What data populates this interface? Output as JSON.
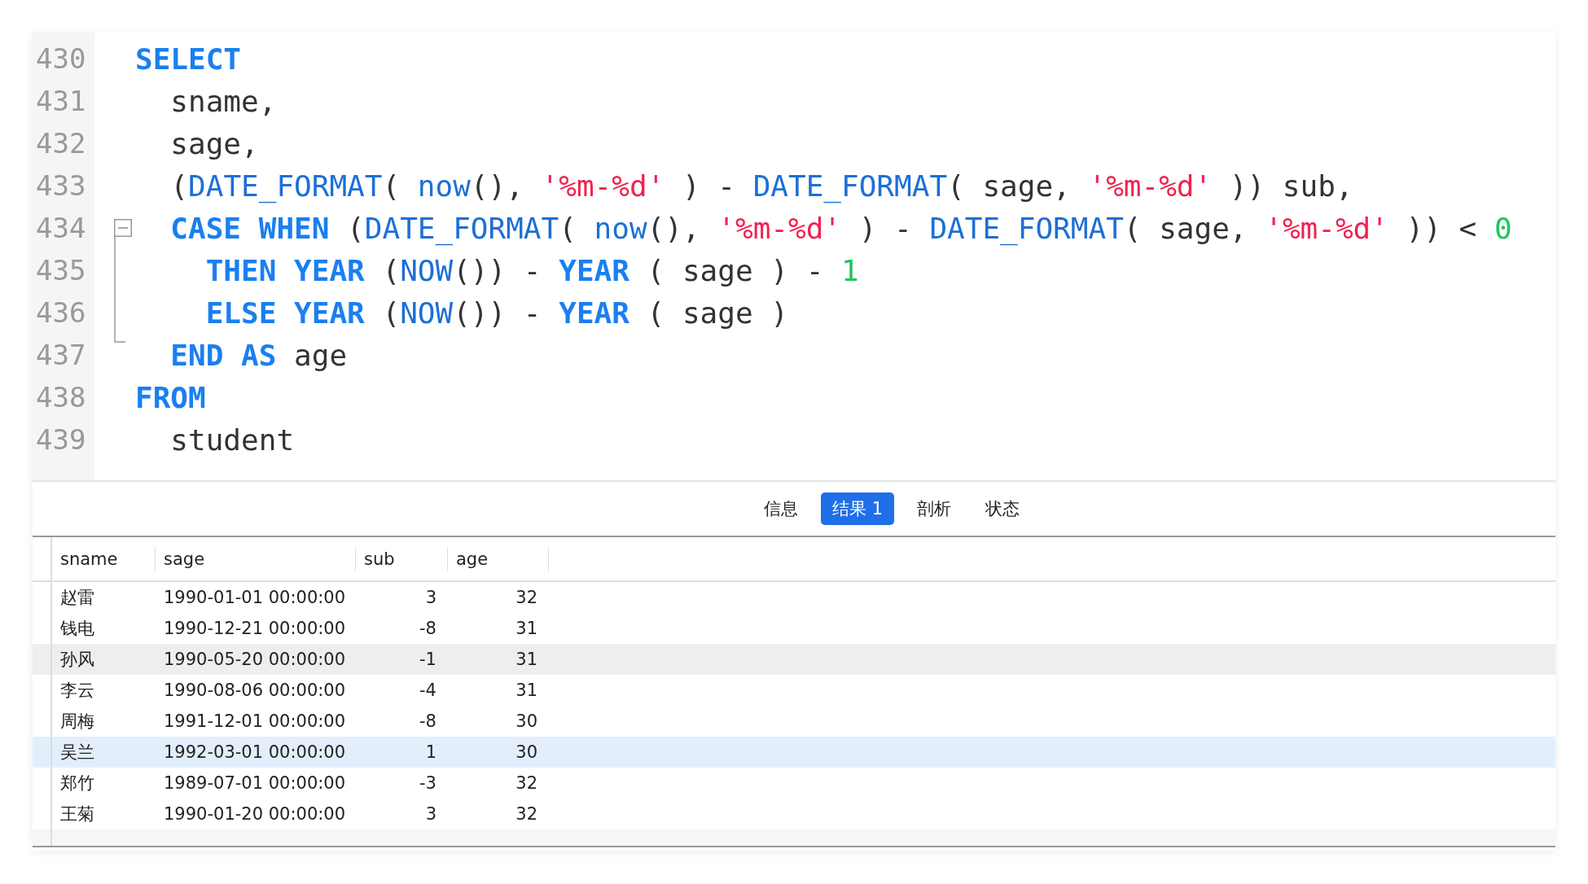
{
  "editor": {
    "lines": [
      {
        "number": "430",
        "tokens": [
          {
            "kind": "keyword",
            "text": "SELECT"
          }
        ]
      },
      {
        "number": "431",
        "tokens": [
          {
            "kind": "plain",
            "text": "  sname,"
          }
        ]
      },
      {
        "number": "432",
        "tokens": [
          {
            "kind": "plain",
            "text": "  sage,"
          }
        ]
      },
      {
        "number": "433",
        "tokens": [
          {
            "kind": "plain",
            "text": "  ("
          },
          {
            "kind": "function",
            "text": "DATE_FORMAT"
          },
          {
            "kind": "plain",
            "text": "( "
          },
          {
            "kind": "function",
            "text": "now"
          },
          {
            "kind": "plain",
            "text": "(), "
          },
          {
            "kind": "string",
            "text": "'%m-%d'"
          },
          {
            "kind": "plain",
            "text": " ) - "
          },
          {
            "kind": "function",
            "text": "DATE_FORMAT"
          },
          {
            "kind": "plain",
            "text": "( sage, "
          },
          {
            "kind": "string",
            "text": "'%m-%d'"
          },
          {
            "kind": "plain",
            "text": " )) sub,"
          }
        ]
      },
      {
        "number": "434",
        "expanded": true,
        "tokens": [
          {
            "kind": "keyword",
            "text": "  CASE WHEN"
          },
          {
            "kind": "plain",
            "text": " ("
          },
          {
            "kind": "function",
            "text": "DATE_FORMAT"
          },
          {
            "kind": "plain",
            "text": "( "
          },
          {
            "kind": "function",
            "text": "now"
          },
          {
            "kind": "plain",
            "text": "(), "
          },
          {
            "kind": "string",
            "text": "'%m-%d'"
          },
          {
            "kind": "plain",
            "text": " ) - "
          },
          {
            "kind": "function",
            "text": "DATE_FORMAT"
          },
          {
            "kind": "plain",
            "text": "( sage, "
          },
          {
            "kind": "string",
            "text": "'%m-%d'"
          },
          {
            "kind": "plain",
            "text": " )) < "
          },
          {
            "kind": "number",
            "text": "0"
          }
        ],
        "children": [
          {
            "number": "435",
            "tokens": [
              {
                "kind": "keyword",
                "text": "    THEN YEAR"
              },
              {
                "kind": "plain",
                "text": " ("
              },
              {
                "kind": "function",
                "text": "NOW"
              },
              {
                "kind": "plain",
                "text": "()) - "
              },
              {
                "kind": "keyword",
                "text": "YEAR"
              },
              {
                "kind": "plain",
                "text": " ( sage ) - "
              },
              {
                "kind": "number",
                "text": "1"
              }
            ]
          },
          {
            "number": "436",
            "tokens": [
              {
                "kind": "keyword",
                "text": "    ELSE YEAR"
              },
              {
                "kind": "plain",
                "text": " ("
              },
              {
                "kind": "function",
                "text": "NOW"
              },
              {
                "kind": "plain",
                "text": "()) - "
              },
              {
                "kind": "keyword",
                "text": "YEAR"
              },
              {
                "kind": "plain",
                "text": " ( sage )"
              }
            ]
          },
          {
            "number": "437",
            "tokens": [
              {
                "kind": "keyword",
                "text": "  END AS"
              },
              {
                "kind": "plain",
                "text": " age"
              }
            ]
          }
        ]
      },
      {
        "number": "438",
        "tokens": [
          {
            "kind": "keyword",
            "text": "FROM"
          }
        ]
      },
      {
        "number": "439",
        "tokens": [
          {
            "kind": "plain",
            "text": "  student"
          }
        ]
      }
    ]
  },
  "tabs": [
    {
      "label": "信息",
      "selected": false
    },
    {
      "label": "结果 1",
      "selected": true
    },
    {
      "label": "剖析",
      "selected": false
    },
    {
      "label": "状态",
      "selected": false
    }
  ],
  "table": {
    "columns": [
      {
        "label": "sname",
        "kind": "text"
      },
      {
        "label": "sage",
        "kind": "text"
      },
      {
        "label": "sub",
        "kind": "number"
      },
      {
        "label": "age",
        "kind": "number"
      }
    ],
    "rows": [
      {
        "cells": [
          "赵雷",
          "1990-01-01 00:00:00",
          "3",
          "32"
        ],
        "selected": false,
        "highlighted": false
      },
      {
        "cells": [
          "钱电",
          "1990-12-21 00:00:00",
          "-8",
          "31"
        ],
        "selected": false,
        "highlighted": false
      },
      {
        "cells": [
          "孙风",
          "1990-05-20 00:00:00",
          "-1",
          "31"
        ],
        "selected": false,
        "highlighted": true
      },
      {
        "cells": [
          "李云",
          "1990-08-06 00:00:00",
          "-4",
          "31"
        ],
        "selected": false,
        "highlighted": false
      },
      {
        "cells": [
          "周梅",
          "1991-12-01 00:00:00",
          "-8",
          "30"
        ],
        "selected": false,
        "highlighted": false
      },
      {
        "cells": [
          "吴兰",
          "1992-03-01 00:00:00",
          "1",
          "30"
        ],
        "selected": true,
        "highlighted": false
      },
      {
        "cells": [
          "郑竹",
          "1989-07-01 00:00:00",
          "-3",
          "32"
        ],
        "selected": false,
        "highlighted": false
      },
      {
        "cells": [
          "王菊",
          "1990-01-20 00:00:00",
          "3",
          "32"
        ],
        "selected": false,
        "highlighted": false
      }
    ]
  }
}
